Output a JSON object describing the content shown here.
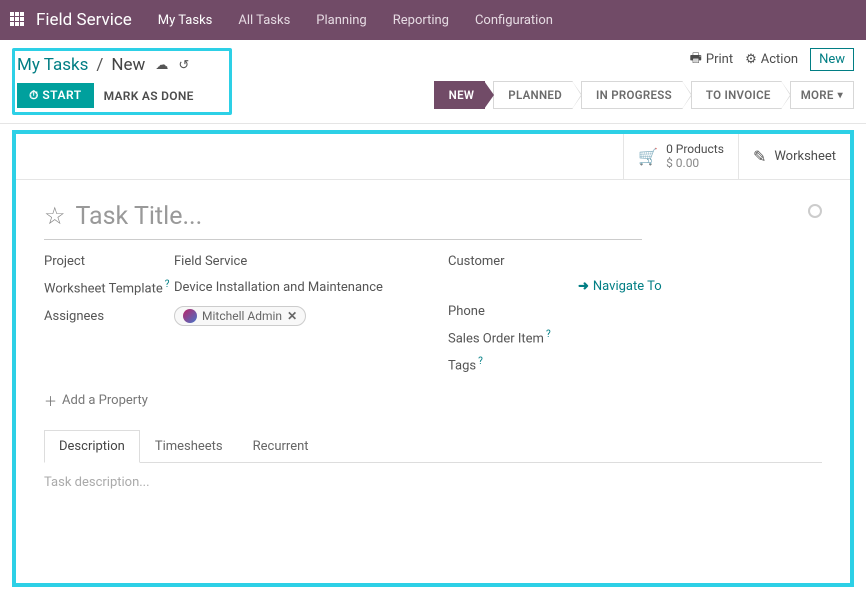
{
  "nav": {
    "app": "Field Service",
    "items": [
      "My Tasks",
      "All Tasks",
      "Planning",
      "Reporting",
      "Configuration"
    ]
  },
  "breadcrumb": {
    "parent": "My Tasks",
    "current": "New"
  },
  "cp": {
    "start": "START",
    "done": "MARK AS DONE",
    "print": "Print",
    "action": "Action",
    "newbtn": "New"
  },
  "status": {
    "steps": [
      "NEW",
      "PLANNED",
      "IN PROGRESS",
      "TO INVOICE"
    ],
    "more": "MORE"
  },
  "stats": {
    "products_l1": "0 Products",
    "products_l2": "$ 0.00",
    "worksheet": "Worksheet"
  },
  "form": {
    "title_ph": "Task Title...",
    "labels": {
      "project": "Project",
      "worksheet_tpl": "Worksheet Template",
      "assignees": "Assignees",
      "customer": "Customer",
      "phone": "Phone",
      "so_item": "Sales Order Item",
      "tags": "Tags"
    },
    "values": {
      "project": "Field Service",
      "worksheet_tpl": "Device Installation and Maintenance",
      "assignee_chip": "Mitchell Admin"
    },
    "navigate": "Navigate To",
    "add_prop": "Add a Property",
    "tabs": [
      "Description",
      "Timesheets",
      "Recurrent"
    ],
    "desc_ph": "Task description..."
  }
}
